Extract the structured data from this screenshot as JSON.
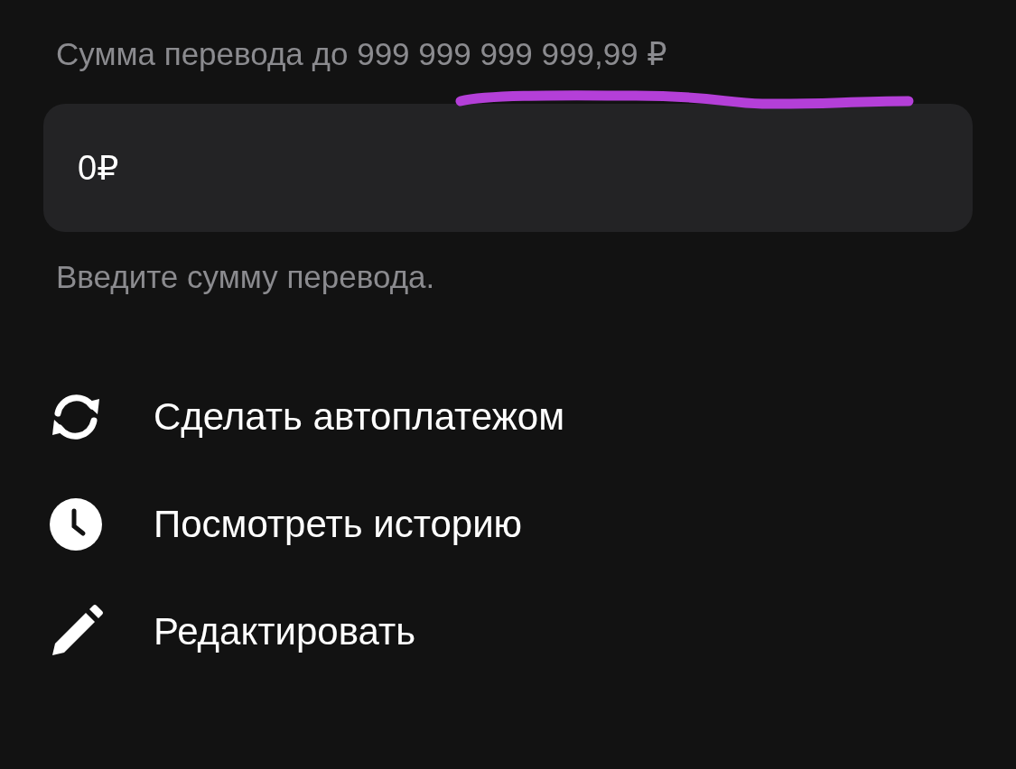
{
  "amount_label": "Сумма перевода до 999 999 999 999,99 ₽",
  "amount_field": {
    "value": "0₽"
  },
  "hint": "Введите сумму перевода.",
  "actions": [
    {
      "kind": "autopay",
      "label": "Сделать автоплатежом"
    },
    {
      "kind": "history",
      "label": "Посмотреть историю"
    },
    {
      "kind": "edit",
      "label": "Редактировать"
    }
  ]
}
